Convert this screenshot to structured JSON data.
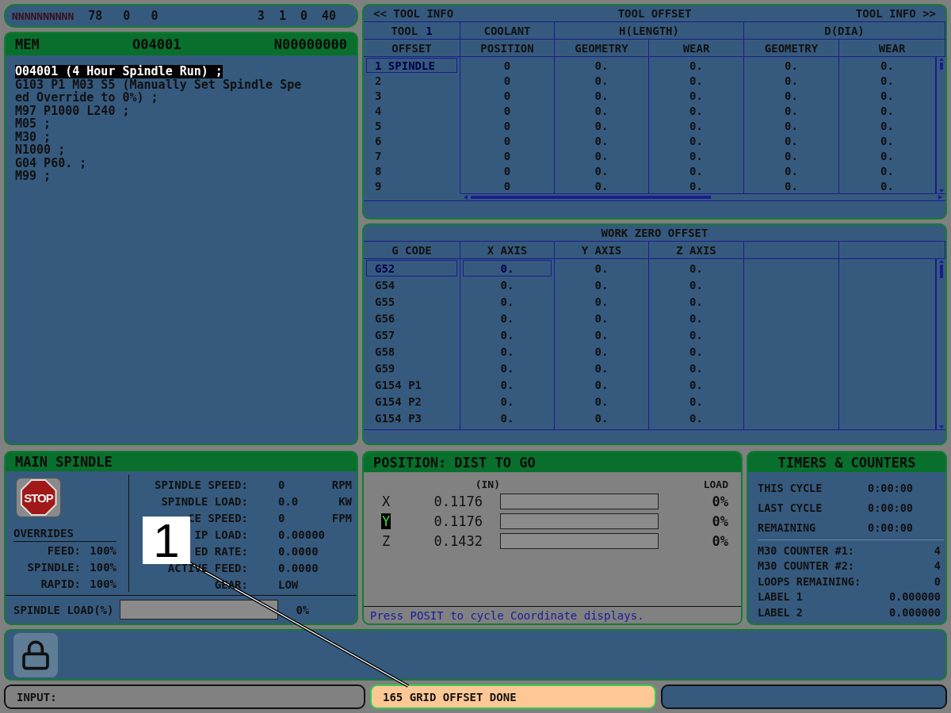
{
  "top_bar": {
    "name": "NNNNNNNNNN",
    "left_values": [
      "78",
      "0",
      "0"
    ],
    "right_values": [
      "3",
      "1",
      "0",
      "40"
    ]
  },
  "program": {
    "mode": "MEM",
    "number": "O04001",
    "sequence": "N00000000",
    "lines": [
      {
        "text": "O04001 (4 Hour Spindle Run) ;",
        "selected": true
      },
      {
        "text": "G103 P1 M03 S5 (Manually Set Spindle Spe",
        "selected": false
      },
      {
        "text": "ed Override to 0%) ;",
        "selected": false
      },
      {
        "text": "M97 P1000 L240 ;",
        "selected": false
      },
      {
        "text": "M05 ;",
        "selected": false
      },
      {
        "text": "M30 ;",
        "selected": false
      },
      {
        "text": "N1000 ;",
        "selected": false
      },
      {
        "text": "G04 P60. ;",
        "selected": false
      },
      {
        "text": "M99 ;",
        "selected": false
      }
    ]
  },
  "tool_offset": {
    "nav_left": "<< TOOL INFO",
    "title": "TOOL OFFSET",
    "nav_right": "TOOL INFO >>",
    "tool_label": "TOOL",
    "tool_number": "1",
    "groups": [
      "COOLANT",
      "H(LENGTH)",
      "D(DIA)"
    ],
    "columns": [
      "OFFSET",
      "POSITION",
      "GEOMETRY",
      "WEAR",
      "GEOMETRY",
      "WEAR"
    ],
    "rows": [
      {
        "cells": [
          "1 SPINDLE",
          "0",
          "0.",
          "0.",
          "0.",
          "0."
        ],
        "selected": true
      },
      {
        "cells": [
          "2",
          "0",
          "0.",
          "0.",
          "0.",
          "0."
        ],
        "selected": false
      },
      {
        "cells": [
          "3",
          "0",
          "0.",
          "0.",
          "0.",
          "0."
        ],
        "selected": false
      },
      {
        "cells": [
          "4",
          "0",
          "0.",
          "0.",
          "0.",
          "0."
        ],
        "selected": false
      },
      {
        "cells": [
          "5",
          "0",
          "0.",
          "0.",
          "0.",
          "0."
        ],
        "selected": false
      },
      {
        "cells": [
          "6",
          "0",
          "0.",
          "0.",
          "0.",
          "0."
        ],
        "selected": false
      },
      {
        "cells": [
          "7",
          "0",
          "0.",
          "0.",
          "0.",
          "0."
        ],
        "selected": false
      },
      {
        "cells": [
          "8",
          "0",
          "0.",
          "0.",
          "0.",
          "0."
        ],
        "selected": false
      },
      {
        "cells": [
          "9",
          "0",
          "0.",
          "0.",
          "0.",
          "0."
        ],
        "selected": false
      }
    ]
  },
  "work_zero_offset": {
    "title": "WORK ZERO OFFSET",
    "columns": [
      "G CODE",
      "X AXIS",
      "Y AXIS",
      "Z AXIS"
    ],
    "rows": [
      {
        "code": "G52",
        "selected": true,
        "values": [
          {
            "text": "0.",
            "selected": true
          },
          {
            "text": "0.",
            "selected": false
          },
          {
            "text": "0.",
            "selected": false
          }
        ]
      },
      {
        "code": "G54",
        "selected": false,
        "values": [
          {
            "text": "0.",
            "selected": false
          },
          {
            "text": "0.",
            "selected": false
          },
          {
            "text": "0.",
            "selected": false
          }
        ]
      },
      {
        "code": "G55",
        "selected": false,
        "values": [
          {
            "text": "0.",
            "selected": false
          },
          {
            "text": "0.",
            "selected": false
          },
          {
            "text": "0.",
            "selected": false
          }
        ]
      },
      {
        "code": "G56",
        "selected": false,
        "values": [
          {
            "text": "0.",
            "selected": false
          },
          {
            "text": "0.",
            "selected": false
          },
          {
            "text": "0.",
            "selected": false
          }
        ]
      },
      {
        "code": "G57",
        "selected": false,
        "values": [
          {
            "text": "0.",
            "selected": false
          },
          {
            "text": "0.",
            "selected": false
          },
          {
            "text": "0.",
            "selected": false
          }
        ]
      },
      {
        "code": "G58",
        "selected": false,
        "values": [
          {
            "text": "0.",
            "selected": false
          },
          {
            "text": "0.",
            "selected": false
          },
          {
            "text": "0.",
            "selected": false
          }
        ]
      },
      {
        "code": "G59",
        "selected": false,
        "values": [
          {
            "text": "0.",
            "selected": false
          },
          {
            "text": "0.",
            "selected": false
          },
          {
            "text": "0.",
            "selected": false
          }
        ]
      },
      {
        "code": "G154 P1",
        "selected": false,
        "values": [
          {
            "text": "0.",
            "selected": false
          },
          {
            "text": "0.",
            "selected": false
          },
          {
            "text": "0.",
            "selected": false
          }
        ]
      },
      {
        "code": "G154 P2",
        "selected": false,
        "values": [
          {
            "text": "0.",
            "selected": false
          },
          {
            "text": "0.",
            "selected": false
          },
          {
            "text": "0.",
            "selected": false
          }
        ]
      },
      {
        "code": "G154 P3",
        "selected": false,
        "values": [
          {
            "text": "0.",
            "selected": false
          },
          {
            "text": "0.",
            "selected": false
          },
          {
            "text": "0.",
            "selected": false
          }
        ]
      }
    ]
  },
  "main_spindle": {
    "title": "MAIN SPINDLE",
    "stop_button": {
      "label": "STOP"
    },
    "overrides": {
      "title": "OVERRIDES",
      "items": [
        {
          "label": "FEED:",
          "value": "100%"
        },
        {
          "label": "SPINDLE:",
          "value": "100%"
        },
        {
          "label": "RAPID:",
          "value": "100%"
        }
      ]
    },
    "readings": [
      {
        "label": "SPINDLE SPEED:",
        "value": "0",
        "unit": "RPM"
      },
      {
        "label": "SPINDLE LOAD:",
        "value": "0.0",
        "unit": "KW"
      },
      {
        "label": "CE SPEED:",
        "value": "0",
        "unit": "FPM"
      },
      {
        "label": "IP LOAD:",
        "value": "0.00000"
      },
      {
        "label": "ED RATE:",
        "value": "0.0000"
      },
      {
        "label": "ACTIVE FEED:",
        "value": "0.0000"
      },
      {
        "label": "GEAR:",
        "value": "LOW"
      }
    ],
    "load": {
      "label": "SPINDLE LOAD(%)",
      "level": 0,
      "reading": "0%"
    }
  },
  "position": {
    "title": "POSITION: DIST TO GO",
    "unit": "(IN)",
    "load_header": "LOAD",
    "axes": [
      {
        "name": "X",
        "value": "0.1176",
        "level": 0,
        "reading": "0%",
        "selected": false
      },
      {
        "name": "Y",
        "value": "0.1176",
        "level": 0,
        "reading": "0%",
        "selected": true
      },
      {
        "name": "Z",
        "value": "0.1432",
        "level": 0,
        "reading": "0%",
        "selected": false
      }
    ],
    "hint": "Press POSIT to cycle Coordinate displays."
  },
  "timers_counters": {
    "title": "TIMERS & COUNTERS",
    "timers": [
      {
        "label": "THIS CYCLE",
        "value": "0:00:00"
      },
      {
        "label": "LAST CYCLE",
        "value": "0:00:00"
      },
      {
        "label": "REMAINING",
        "value": "0:00:00"
      }
    ],
    "counters": [
      {
        "label": "M30 COUNTER #1:",
        "value": "4"
      },
      {
        "label": "M30 COUNTER #2:",
        "value": "4"
      },
      {
        "label": "LOOPS REMAINING:",
        "value": "0"
      },
      {
        "label": "LABEL 1",
        "value": "0.000000"
      },
      {
        "label": "LABEL 2",
        "value": "0.000000"
      }
    ]
  },
  "status_bar": {
    "input_label": "INPUT:",
    "message": "165 GRID OFFSET DONE"
  },
  "callout": {
    "label": "1"
  }
}
